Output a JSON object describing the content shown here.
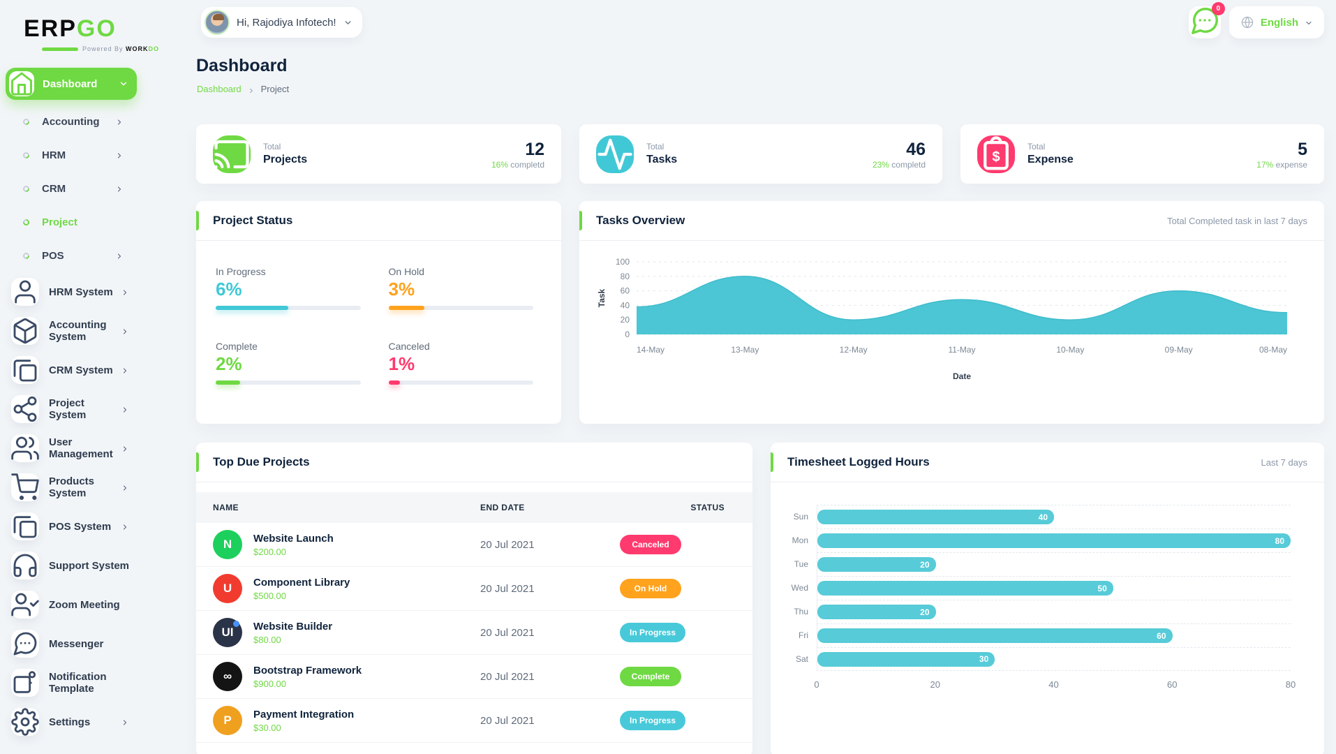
{
  "brand": {
    "logo_erp": "ERP",
    "logo_go": "GO",
    "powered_prefix": "Powered By",
    "powered_work": "WORK",
    "powered_do": "DO"
  },
  "header": {
    "greeting": "Hi, Rajodiya Infotech!",
    "message_badge": "0",
    "language": "English"
  },
  "sidebar": {
    "active_item": {
      "label": "Dashboard",
      "icon": "home-icon"
    },
    "dashboard_children": [
      {
        "label": "Accounting",
        "chevron": true,
        "active": false
      },
      {
        "label": "HRM",
        "chevron": true,
        "active": false
      },
      {
        "label": "CRM",
        "chevron": true,
        "active": false
      },
      {
        "label": "Project",
        "chevron": false,
        "active": true
      },
      {
        "label": "POS",
        "chevron": true,
        "active": false
      }
    ],
    "modules": [
      {
        "label": "HRM System",
        "icon": "user-icon",
        "chevron": true
      },
      {
        "label": "Accounting System",
        "icon": "cube-icon",
        "chevron": true
      },
      {
        "label": "CRM System",
        "icon": "browser-icon",
        "chevron": true
      },
      {
        "label": "Project System",
        "icon": "share-icon",
        "chevron": true
      },
      {
        "label": "User Management",
        "icon": "users-icon",
        "chevron": true
      },
      {
        "label": "Products System",
        "icon": "cart-icon",
        "chevron": true
      },
      {
        "label": "POS System",
        "icon": "browser-icon",
        "chevron": true
      },
      {
        "label": "Support System",
        "icon": "headphones-icon",
        "chevron": false
      },
      {
        "label": "Zoom Meeting",
        "icon": "user-check-icon",
        "chevron": false
      },
      {
        "label": "Messenger",
        "icon": "chat-icon",
        "chevron": false
      },
      {
        "label": "Notification Template",
        "icon": "template-icon",
        "chevron": false
      },
      {
        "label": "Settings",
        "icon": "gear-icon",
        "chevron": true
      }
    ]
  },
  "page": {
    "title": "Dashboard",
    "breadcrumb": [
      "Dashboard",
      "Project"
    ]
  },
  "stats": [
    {
      "label_top": "Total",
      "label": "Projects",
      "value": "12",
      "sub_pct": "16%",
      "sub_text": "completd",
      "icon": "cast-icon",
      "color": "#6fd943"
    },
    {
      "label_top": "Total",
      "label": "Tasks",
      "value": "46",
      "sub_pct": "23%",
      "sub_text": "completd",
      "icon": "activity-icon",
      "color": "#41c8d6"
    },
    {
      "label_top": "Total",
      "label": "Expense",
      "value": "5",
      "sub_pct": "17%",
      "sub_text": "expense",
      "icon": "clipboard-dollar-icon",
      "color": "#ff3a6e"
    }
  ],
  "project_status": {
    "title": "Project Status",
    "items": [
      {
        "label": "In Progress",
        "pct": "6%",
        "bar_pct": 50,
        "color": "#41c8d6"
      },
      {
        "label": "On Hold",
        "pct": "3%",
        "bar_pct": 25,
        "color": "#ffa21d"
      },
      {
        "label": "Complete",
        "pct": "2%",
        "bar_pct": 17,
        "color": "#6fd943"
      },
      {
        "label": "Canceled",
        "pct": "1%",
        "bar_pct": 8,
        "color": "#ff3a6e"
      }
    ]
  },
  "tasks_overview": {
    "title": "Tasks Overview",
    "subtitle": "Total Completed task in last 7 days"
  },
  "top_due": {
    "title": "Top Due Projects",
    "columns": [
      "NAME",
      "END DATE",
      "STATUS"
    ],
    "rows": [
      {
        "name": "Website Launch",
        "amount": "$200.00",
        "end_date": "20 Jul 2021",
        "status": "Canceled",
        "status_color": "#ff3a6e",
        "avatar_text": "N",
        "avatar_bg": "#1dd05d"
      },
      {
        "name": "Component Library",
        "amount": "$500.00",
        "end_date": "20 Jul 2021",
        "status": "On Hold",
        "status_color": "#ffa21d",
        "avatar_text": "U",
        "avatar_bg": "#f23b2f"
      },
      {
        "name": "Website Builder",
        "amount": "$80.00",
        "end_date": "20 Jul 2021",
        "status": "In Progress",
        "status_color": "#48c9d9",
        "avatar_text": "UI",
        "avatar_bg": "#2b3348",
        "avatar_dot": "#4a90ff"
      },
      {
        "name": "Bootstrap Framework",
        "amount": "$900.00",
        "end_date": "20 Jul 2021",
        "status": "Complete",
        "status_color": "#6fd943",
        "avatar_text": "∞",
        "avatar_bg": "#141414"
      },
      {
        "name": "Payment Integration",
        "amount": "$30.00",
        "end_date": "20 Jul 2021",
        "status": "In Progress",
        "status_color": "#48c9d9",
        "avatar_text": "P",
        "avatar_bg": "#f0a01f"
      }
    ]
  },
  "timesheet": {
    "title": "Timesheet Logged Hours",
    "subtitle": "Last 7 days"
  },
  "chart_data": [
    {
      "type": "area",
      "title": "Tasks Overview",
      "x": [
        "14-May",
        "13-May",
        "12-May",
        "11-May",
        "10-May",
        "09-May",
        "08-May"
      ],
      "values": [
        38,
        80,
        20,
        48,
        20,
        60,
        30
      ],
      "xlabel": "Date",
      "ylabel": "Task",
      "ylim": [
        0,
        100
      ],
      "yticks": [
        0,
        20,
        40,
        60,
        80,
        100
      ],
      "color": "#4cc6d4",
      "grid": "horizontal-dashed",
      "legend": "none"
    },
    {
      "type": "bar",
      "title": "Timesheet Logged Hours",
      "orientation": "horizontal",
      "categories": [
        "Sun",
        "Mon",
        "Tue",
        "Wed",
        "Thu",
        "Fri",
        "Sat"
      ],
      "values": [
        40,
        80,
        20,
        50,
        20,
        60,
        30
      ],
      "xlim": [
        0,
        80
      ],
      "xticks": [
        0,
        20,
        40,
        60,
        80
      ],
      "color": "#57cbd8",
      "grid": "row-dashed",
      "legend": "none"
    }
  ]
}
